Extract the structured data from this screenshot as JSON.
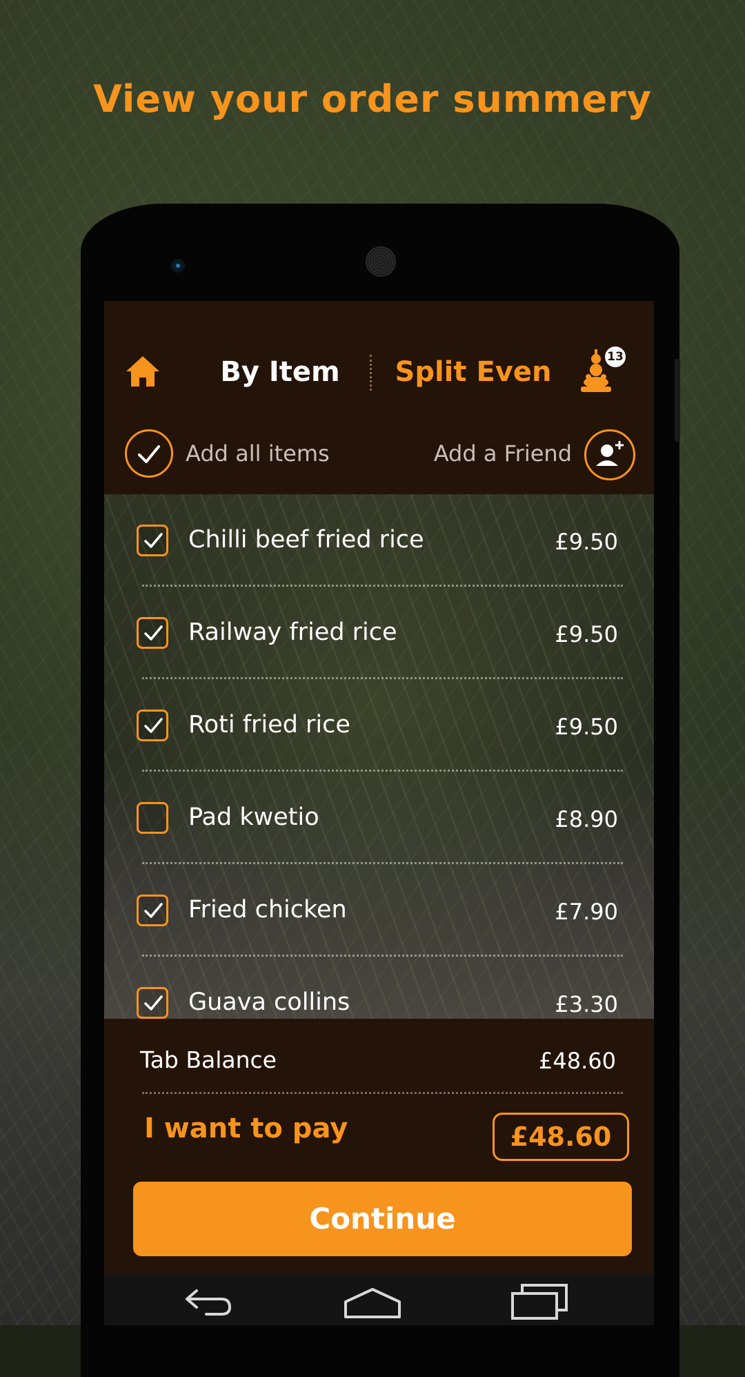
{
  "headline": "View your order summery",
  "header": {
    "tab_by_item": "By Item",
    "tab_split_even": "Split Even",
    "guest_count": "13",
    "icons": [
      "home-icon",
      "guests-icon"
    ]
  },
  "actions": {
    "add_all_label": "Add all items",
    "add_friend_label": "Add a Friend"
  },
  "items": [
    {
      "name": "Chilli beef fried rice",
      "price": "£9.50",
      "checked": true
    },
    {
      "name": "Railway fried rice",
      "price": "£9.50",
      "checked": true
    },
    {
      "name": "Roti fried rice",
      "price": "£9.50",
      "checked": true
    },
    {
      "name": "Pad kwetio",
      "price": "£8.90",
      "checked": false
    },
    {
      "name": "Fried chicken",
      "price": "£7.90",
      "checked": true
    },
    {
      "name": "Guava collins",
      "price": "£3.30",
      "checked": true
    }
  ],
  "summary": {
    "tab_balance_label": "Tab Balance",
    "tab_balance_value": "£48.60",
    "want_to_pay_label": "I want to pay",
    "pay_amount": "£48.60",
    "continue_label": "Continue"
  },
  "colors": {
    "accent": "#f7941d",
    "panel": "#241308",
    "text": "#ffffff"
  }
}
